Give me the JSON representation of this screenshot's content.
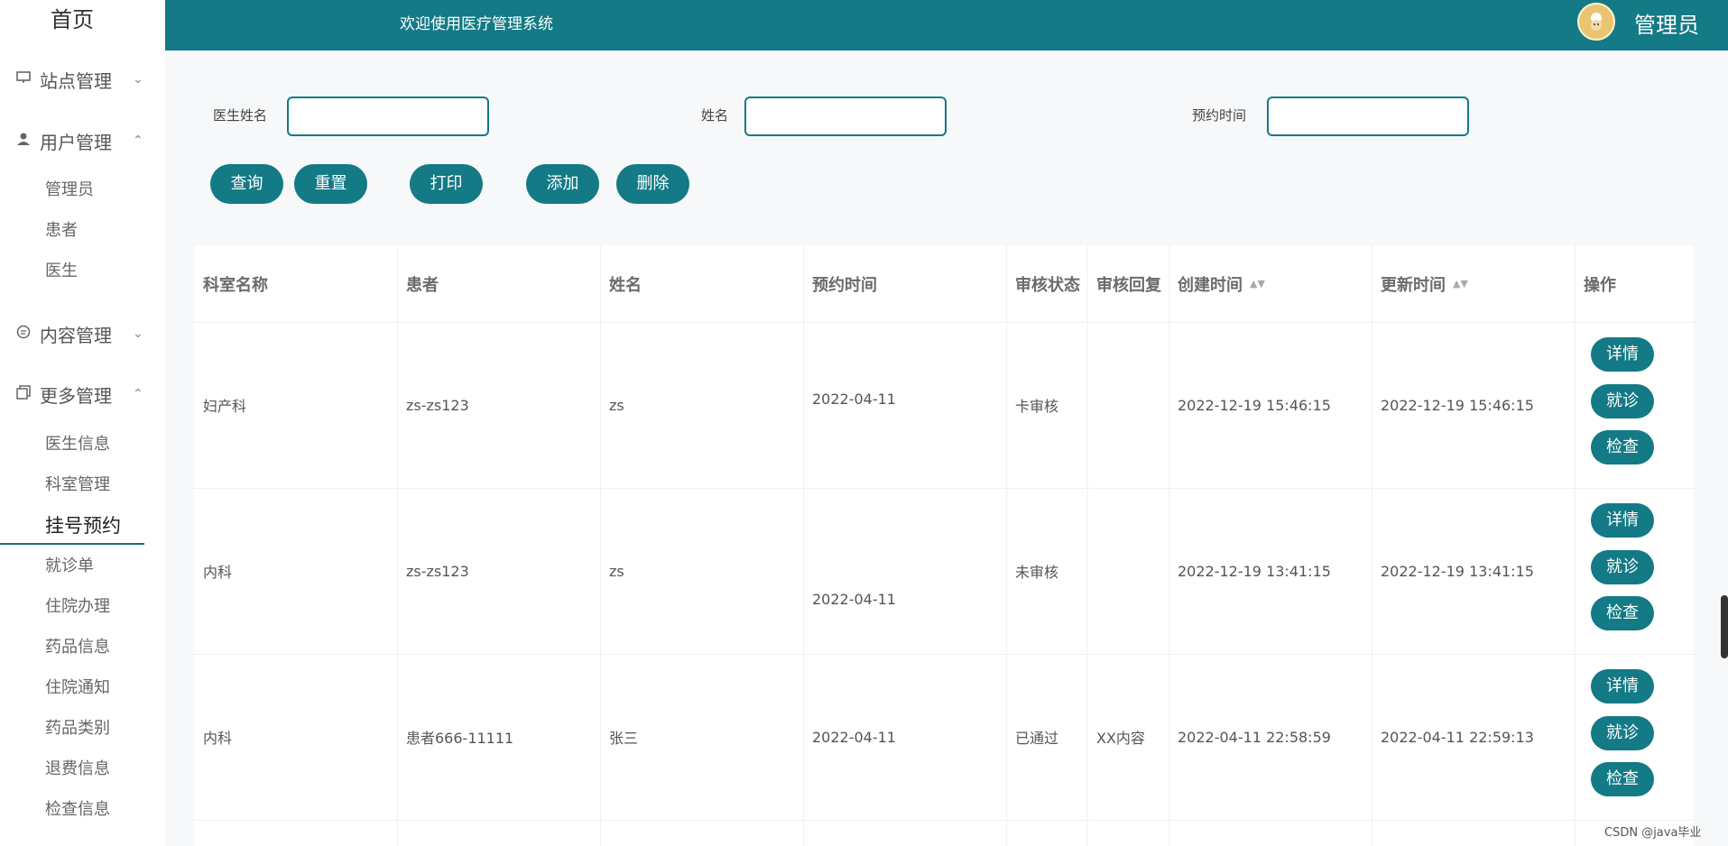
{
  "sidebar": {
    "home": "首页",
    "groups": [
      {
        "label": "站点管理",
        "icon": "monitor-icon"
      },
      {
        "label": "用户管理",
        "icon": "user-icon"
      },
      {
        "label": "内容管理",
        "icon": "chat-icon"
      },
      {
        "label": "更多管理",
        "icon": "copy-icon"
      }
    ],
    "user_items": [
      "管理员",
      "患者",
      "医生"
    ],
    "more_items": [
      "医生信息",
      "科室管理",
      "挂号预约",
      "就诊单",
      "住院办理",
      "药品信息",
      "住院通知",
      "药品类别",
      "退费信息",
      "检查信息"
    ],
    "active": "挂号预约"
  },
  "header": {
    "welcome": "欢迎使用医疗管理系统",
    "admin_label": "管理员",
    "brand_color": "#137a86"
  },
  "filters": {
    "doctor_label": "医生姓名",
    "name_label": "姓名",
    "time_label": "预约时间",
    "doctor_value": "",
    "name_value": "",
    "time_value": ""
  },
  "actions": {
    "query": "查询",
    "reset": "重置",
    "print": "打印",
    "add": "添加",
    "delete": "删除"
  },
  "table": {
    "headers": [
      "科室名称",
      "患者",
      "姓名",
      "预约时间",
      "审核状态",
      "审核回复",
      "创建时间",
      "更新时间",
      "操作"
    ],
    "rows": [
      {
        "dept": "妇产科",
        "patient": "zs-zs123",
        "name": "zs",
        "time": "2022-04-11",
        "status": "卡审核",
        "reply": "",
        "created": "2022-12-19 15:46:15",
        "updated": "2022-12-19 15:46:15"
      },
      {
        "dept": "内科",
        "patient": "zs-zs123",
        "name": "zs",
        "time": "2022-04-11",
        "status": "未审核",
        "reply": "",
        "created": "2022-12-19 13:41:15",
        "updated": "2022-12-19 13:41:15"
      },
      {
        "dept": "内科",
        "patient": "患者666-11111",
        "name": "张三",
        "time": "2022-04-11",
        "status": "已通过",
        "reply": "XX内容",
        "created": "2022-04-11 22:58:59",
        "updated": "2022-04-11 22:59:13"
      }
    ],
    "row_actions": {
      "detail": "详情",
      "visit": "就诊",
      "check": "检查"
    }
  },
  "watermark": "CSDN @java毕业"
}
